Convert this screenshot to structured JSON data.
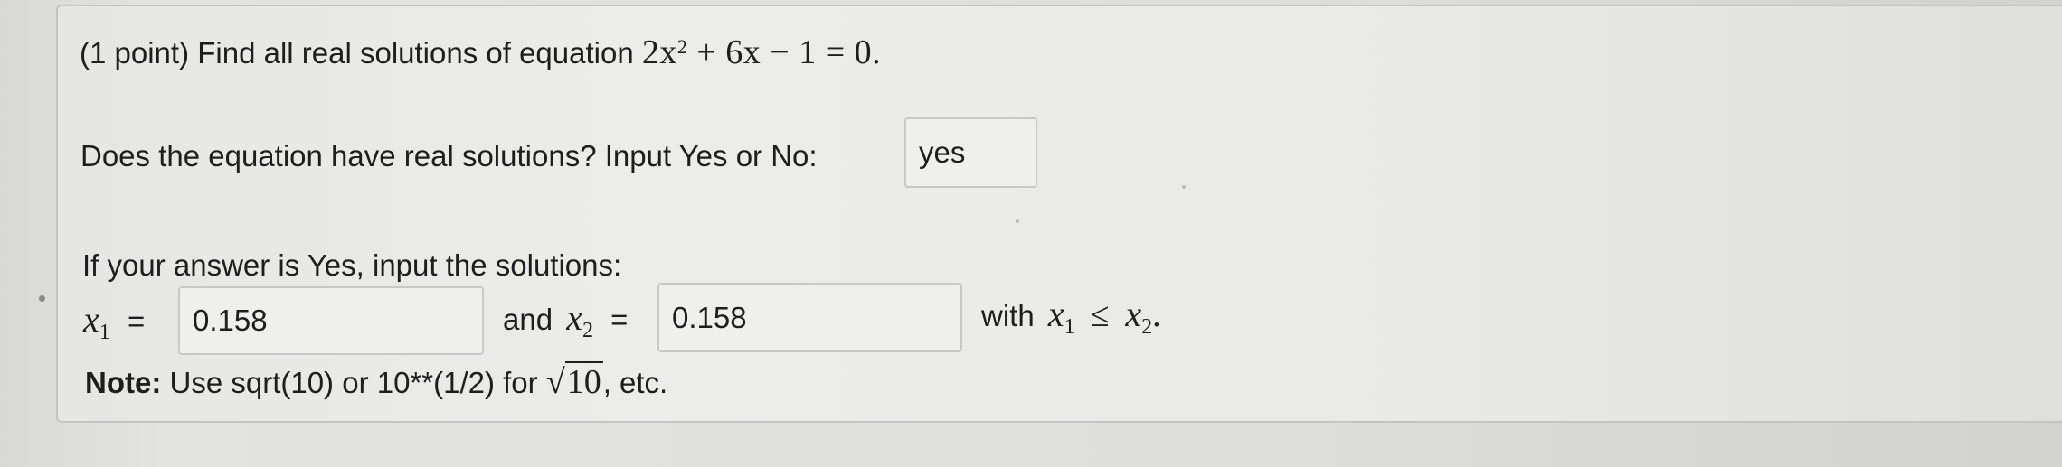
{
  "problem": {
    "points": "(1 point)",
    "prompt": "Find all real solutions of equation",
    "equation": {
      "lead": "2x",
      "exp": "2",
      "rest": " + 6x − 1 = 0."
    }
  },
  "question_real": {
    "label": "Does the equation have real solutions? Input Yes or No:",
    "answer": "yes"
  },
  "solutions": {
    "intro": "If your answer is Yes, input the solutions:",
    "x1_var": "x",
    "x1_sub": "1",
    "x1_eq": "=",
    "x1_value": "0.158",
    "and_label": "and",
    "x2_var": "x",
    "x2_sub": "2",
    "x2_eq": "=",
    "x2_value": "0.158",
    "with_label": "with",
    "cond_x1_var": "x",
    "cond_x1_sub": "1",
    "cond_op": "≤",
    "cond_x2_var": "x",
    "cond_x2_sub": "2",
    "cond_end": "."
  },
  "note": {
    "label": "Note:",
    "text": "Use sqrt(10) or 10**(1/2) for",
    "sqrt_radicand": "10",
    "tail": ", etc."
  }
}
